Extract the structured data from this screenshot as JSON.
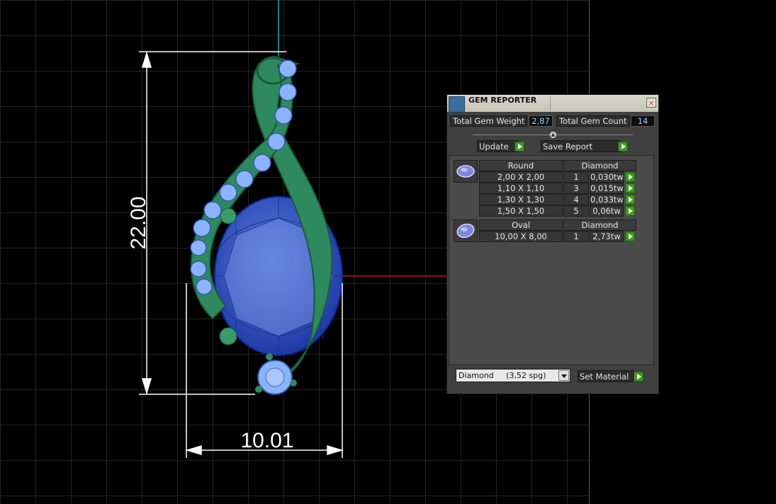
{
  "dimensions": {
    "height_label": "22.00",
    "width_label": "10.01"
  },
  "gem_reporter": {
    "title": "GEM REPORTER",
    "close_label": "×",
    "total_weight_label": "Total Gem Weight",
    "total_weight_value": "2,87",
    "total_count_label": "Total Gem Count",
    "total_count_value": "14",
    "update_label": "Update",
    "save_report_label": "Save Report",
    "groups": [
      {
        "shape": "Round",
        "material": "Diamond",
        "rows": [
          {
            "size": "2,00 X 2,00",
            "count": "1",
            "weight": "0,030tw"
          },
          {
            "size": "1,10 X 1,10",
            "count": "3",
            "weight": "0,015tw"
          },
          {
            "size": "1,30 X 1,30",
            "count": "4",
            "weight": "0,033tw"
          },
          {
            "size": "1,50 X 1,50",
            "count": "5",
            "weight": "0,06tw"
          }
        ]
      },
      {
        "shape": "Oval",
        "material": "Diamond",
        "rows": [
          {
            "size": "10,00 X 8,00",
            "count": "1",
            "weight": "2,73tw"
          }
        ]
      }
    ],
    "material_select_value": "Diamond     (3,52 spg)",
    "set_material_label": "Set Material"
  },
  "colors": {
    "background": "#000000",
    "grid": "#4d4d4d",
    "metal": "#2e8a5e",
    "center_gem": "#2a4ab8",
    "side_gems": "#8ab4ff",
    "axis_x": "#c01818",
    "axis_y": "#2aa8b8",
    "dimension_lines": "#ffffff",
    "panel_bg": "#404040",
    "accent_button": "#3c9a1e"
  }
}
